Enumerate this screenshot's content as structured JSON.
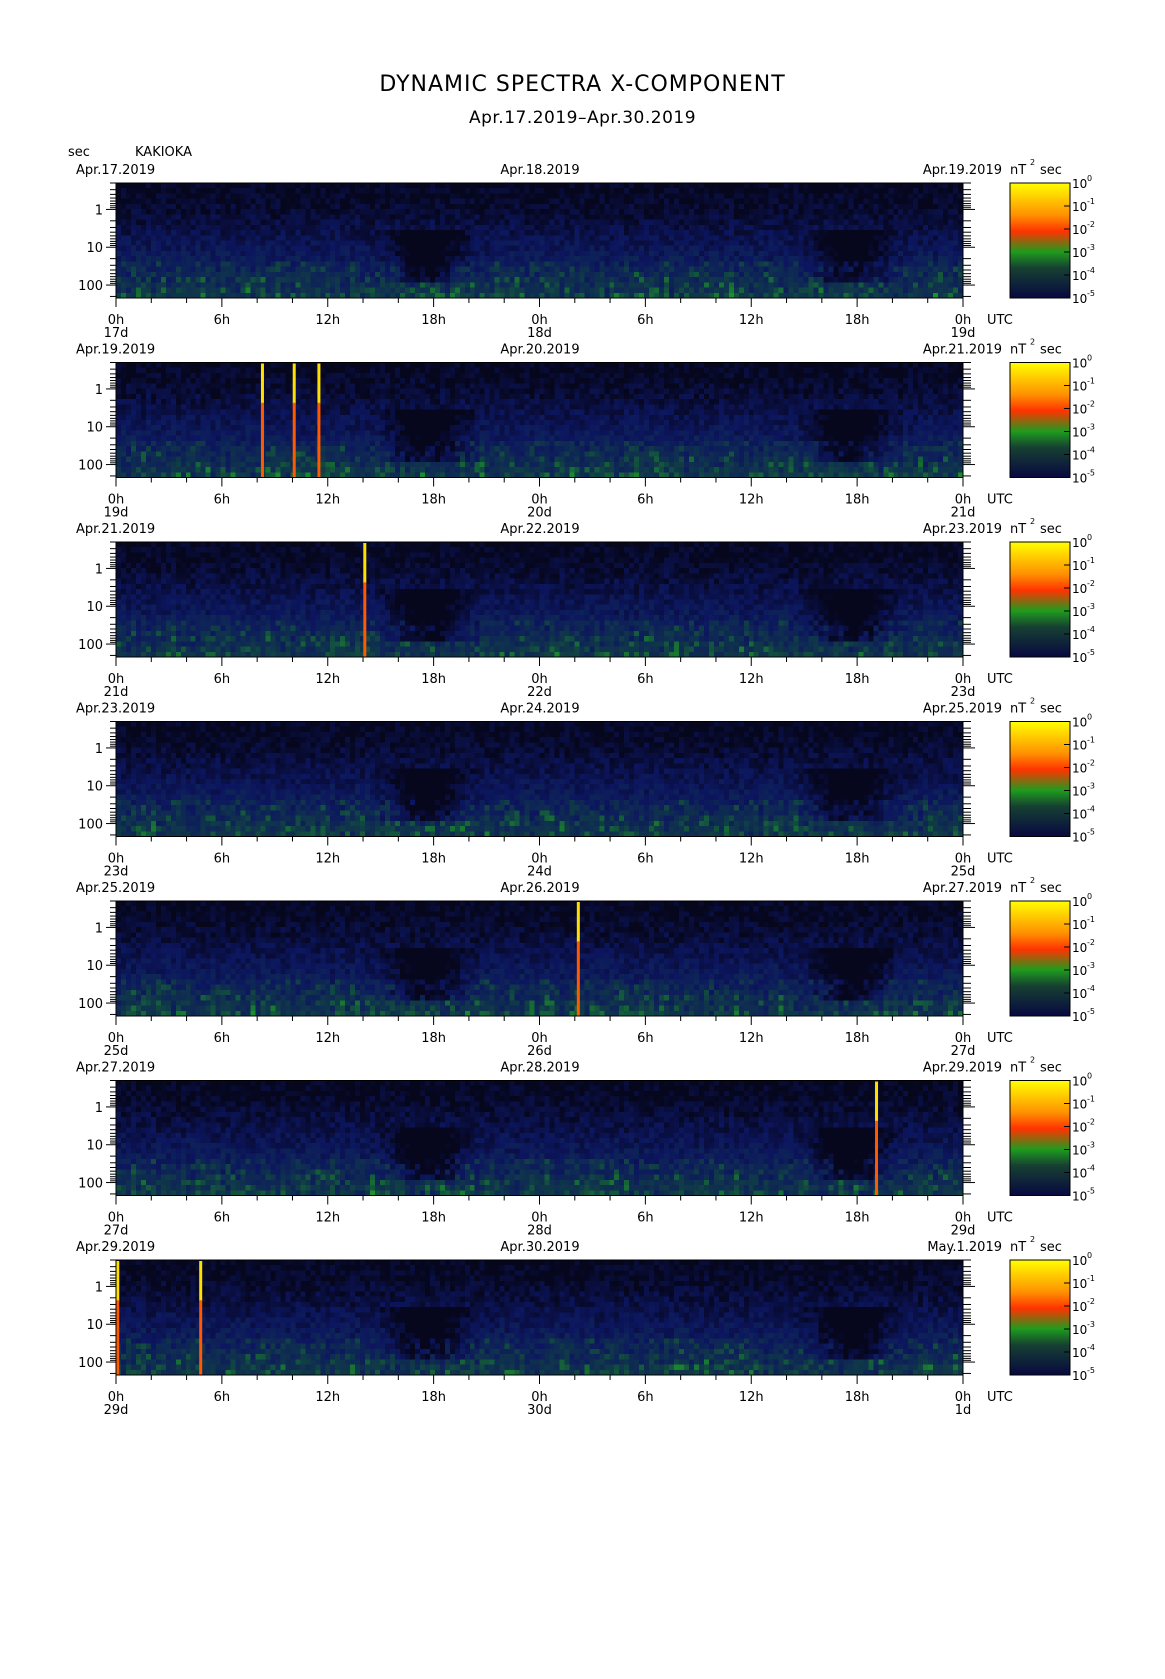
{
  "chart_data": {
    "type": "heatmap",
    "title": "DYNAMIC SPECTRA X-COMPONENT",
    "subtitle": "Apr.17.2019–Apr.30.2019",
    "station": "KAKIOKA",
    "ylabel": "sec",
    "y_scale": "log",
    "y_ticks": [
      "1",
      "10",
      "100"
    ],
    "x_ticks": [
      "0h",
      "6h",
      "12h",
      "18h",
      "0h",
      "6h",
      "12h",
      "18h",
      "0h"
    ],
    "x_unit": "UTC",
    "colorbar": {
      "unit": "nT",
      "unit_exponent": "2",
      "unit_suffix": "sec",
      "scale": "log",
      "base": "10",
      "exponents": [
        "0",
        "-1",
        "-2",
        "-3",
        "-4",
        "-5"
      ],
      "colors": [
        "#ffff00",
        "#ff3300",
        "#1e9b1e",
        "#080840"
      ]
    },
    "panels": [
      {
        "start_date": "Apr.17.2019",
        "mid_date": "Apr.18.2019",
        "end_date": "Apr.19.2019",
        "day_labels": [
          "17d",
          "18d",
          "19d"
        ],
        "spikes": []
      },
      {
        "start_date": "Apr.19.2019",
        "mid_date": "Apr.20.2019",
        "end_date": "Apr.21.2019",
        "day_labels": [
          "19d",
          "20d",
          "21d"
        ],
        "spikes": [
          8.3,
          10.1,
          11.5
        ]
      },
      {
        "start_date": "Apr.21.2019",
        "mid_date": "Apr.22.2019",
        "end_date": "Apr.23.2019",
        "day_labels": [
          "21d",
          "22d",
          "23d"
        ],
        "spikes": [
          14.1
        ]
      },
      {
        "start_date": "Apr.23.2019",
        "mid_date": "Apr.24.2019",
        "end_date": "Apr.25.2019",
        "day_labels": [
          "23d",
          "24d",
          "25d"
        ],
        "spikes": []
      },
      {
        "start_date": "Apr.25.2019",
        "mid_date": "Apr.26.2019",
        "end_date": "Apr.27.2019",
        "day_labels": [
          "25d",
          "26d",
          "27d"
        ],
        "spikes": [
          26.2
        ]
      },
      {
        "start_date": "Apr.27.2019",
        "mid_date": "Apr.28.2019",
        "end_date": "Apr.29.2019",
        "day_labels": [
          "27d",
          "28d",
          "29d"
        ],
        "spikes": [
          43.1
        ]
      },
      {
        "start_date": "Apr.29.2019",
        "mid_date": "Apr.30.2019",
        "end_date": "May.1.2019",
        "day_labels": [
          "29d",
          "30d",
          "1d"
        ],
        "spikes": [
          0.1,
          4.8
        ]
      }
    ]
  }
}
